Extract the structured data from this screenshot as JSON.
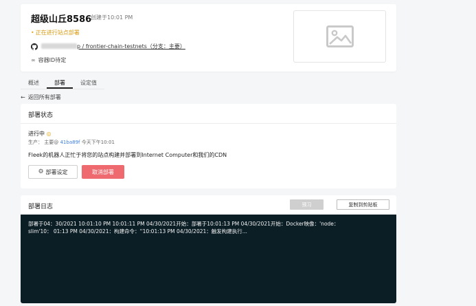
{
  "site": {
    "name": "超级山丘8586",
    "created": "创建于10:01 PM",
    "status": "正在进行站点部署",
    "repo_path": "p / frontier-chain-testnets（分支：主要）",
    "container": "容器ID待定"
  },
  "tabs": [
    {
      "label": "概述"
    },
    {
      "label": "部署"
    },
    {
      "label": "设定值"
    }
  ],
  "back_link": "返回所有部署",
  "deploy_status": {
    "heading": "部署状态",
    "state": "进行中",
    "meta_prefix": "生产：  主要@",
    "commit": "41ba89f",
    "meta_time": "今天下午10:01",
    "description": "Fleek的机器人正忙于将您的站点构建并部署到Internet Computer和我们的CDN",
    "settings_button": "部署设定",
    "cancel_button": "取消部署"
  },
  "deploy_log": {
    "heading": "部署日志",
    "preview_button": "预习",
    "copy_button": "复制到剪贴板",
    "lines": [
      "部署于04：30/2021 10:01:10 PM 10:01:11 PM 04/30/2021开始：部署于10:01:13 PM 04/30/2021开始：Docker映像：'node：",
      "slim'10： 01:13 PM 04/30/2021：构建命令：''10:01:13 PM 04/30/2021：触发构建执行..."
    ]
  },
  "colors": {
    "accent_warning": "#e2a81d",
    "cancel": "#ef6a6f",
    "log_bg": "#0b1e26",
    "commit_link": "#3b7de0"
  }
}
